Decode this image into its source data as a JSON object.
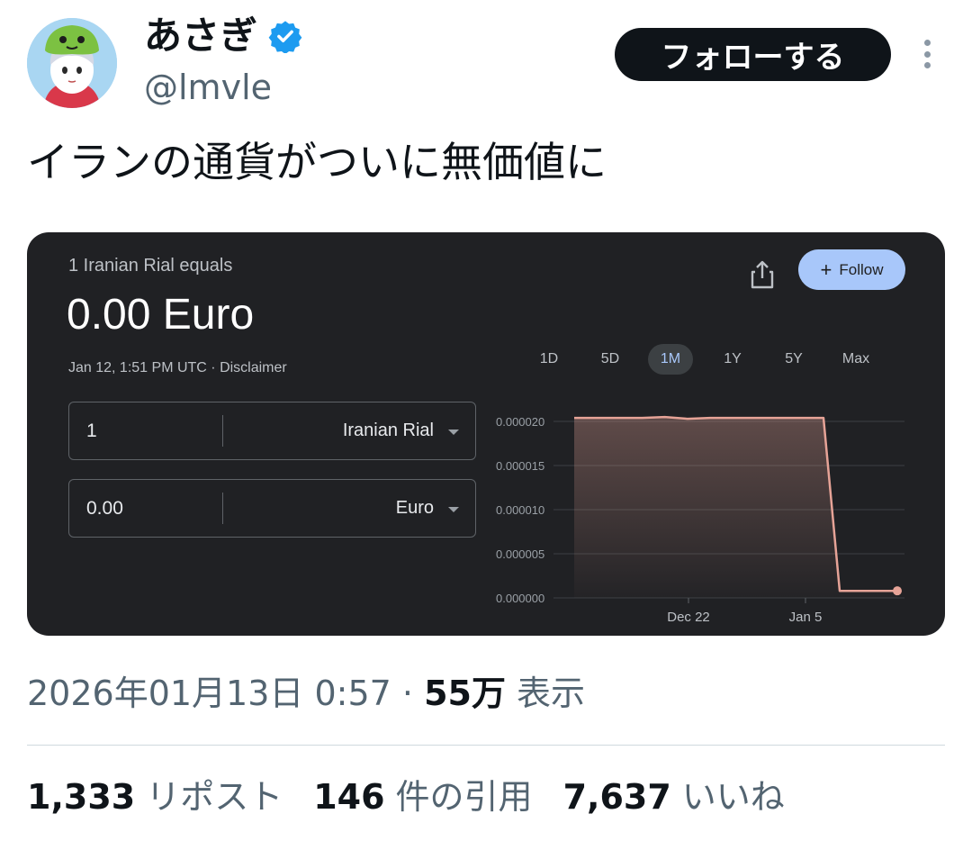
{
  "author": {
    "display_name": "あさぎ",
    "handle": "@lmvle",
    "verified_icon": "verified-badge-icon",
    "follow_label": "フォローする"
  },
  "tweet": {
    "text": "イランの通貨がついに無価値に",
    "date": "2026年01月13日 0:57 · ",
    "views_count": "55万",
    "views_label": " 表示",
    "reposts_count": "1,333",
    "reposts_label": "リポスト",
    "quotes_count": "146",
    "quotes_label": "件の引用",
    "likes_count": "7,637",
    "likes_label": "いいね"
  },
  "card": {
    "equals_label": "1 Iranian Rial equals",
    "value": "0.00 Euro",
    "timestamp": "Jan 12, 1:51 PM UTC · Disclaimer",
    "follow_label": "Follow",
    "ranges": [
      "1D",
      "5D",
      "1M",
      "1Y",
      "5Y",
      "Max"
    ],
    "active_range": "1M",
    "from": {
      "amount": "1",
      "currency": "Iranian Rial"
    },
    "to": {
      "amount": "0.00",
      "currency": "Euro"
    },
    "colors": {
      "background": "#202124",
      "line": "#e6a397",
      "accent": "#a8c7fa"
    }
  },
  "chart_data": {
    "type": "area",
    "x_tick_labels": [
      "Dec 22",
      "Jan 5"
    ],
    "y_tick_labels": [
      "0.000020",
      "0.000015",
      "0.000010",
      "0.000005",
      "0.000000"
    ],
    "ylim": [
      0,
      2e-05
    ],
    "grid": true,
    "series": [
      {
        "values": [
          2.04e-05,
          2.04e-05,
          2.04e-05,
          2.04e-05,
          2.05e-05,
          2.03e-05,
          2.04e-05,
          2.04e-05,
          2.04e-05,
          2.04e-05,
          2.04e-05,
          2.04e-05,
          8e-07,
          8e-07,
          8e-07,
          8e-07,
          8e-07,
          8e-07,
          8e-07,
          8e-07
        ]
      }
    ]
  }
}
